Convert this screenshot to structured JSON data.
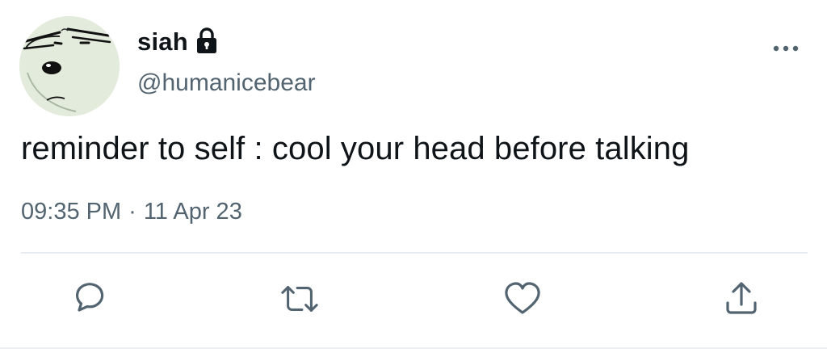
{
  "user": {
    "display_name": "siah",
    "handle": "@humanicebear",
    "protected_icon": "lock-icon",
    "avatar": "polar-bear-avatar"
  },
  "tweet": {
    "text": "reminder to self : cool your head before talking",
    "time": "09:35 PM",
    "separator": "·",
    "date": "11 Apr 23"
  },
  "actions": [
    {
      "name": "reply",
      "icon": "speech-bubble-icon"
    },
    {
      "name": "retweet",
      "icon": "retweet-arrows-icon"
    },
    {
      "name": "like",
      "icon": "heart-icon"
    },
    {
      "name": "share",
      "icon": "share-upload-icon"
    }
  ],
  "more_menu_icon": "ellipsis-icon",
  "colors": {
    "primary_text": "#0f1419",
    "secondary_text": "#536471",
    "action_icon": "#536471",
    "divider": "#e6ecf0",
    "avatar_bg": "#e3ecdc"
  }
}
